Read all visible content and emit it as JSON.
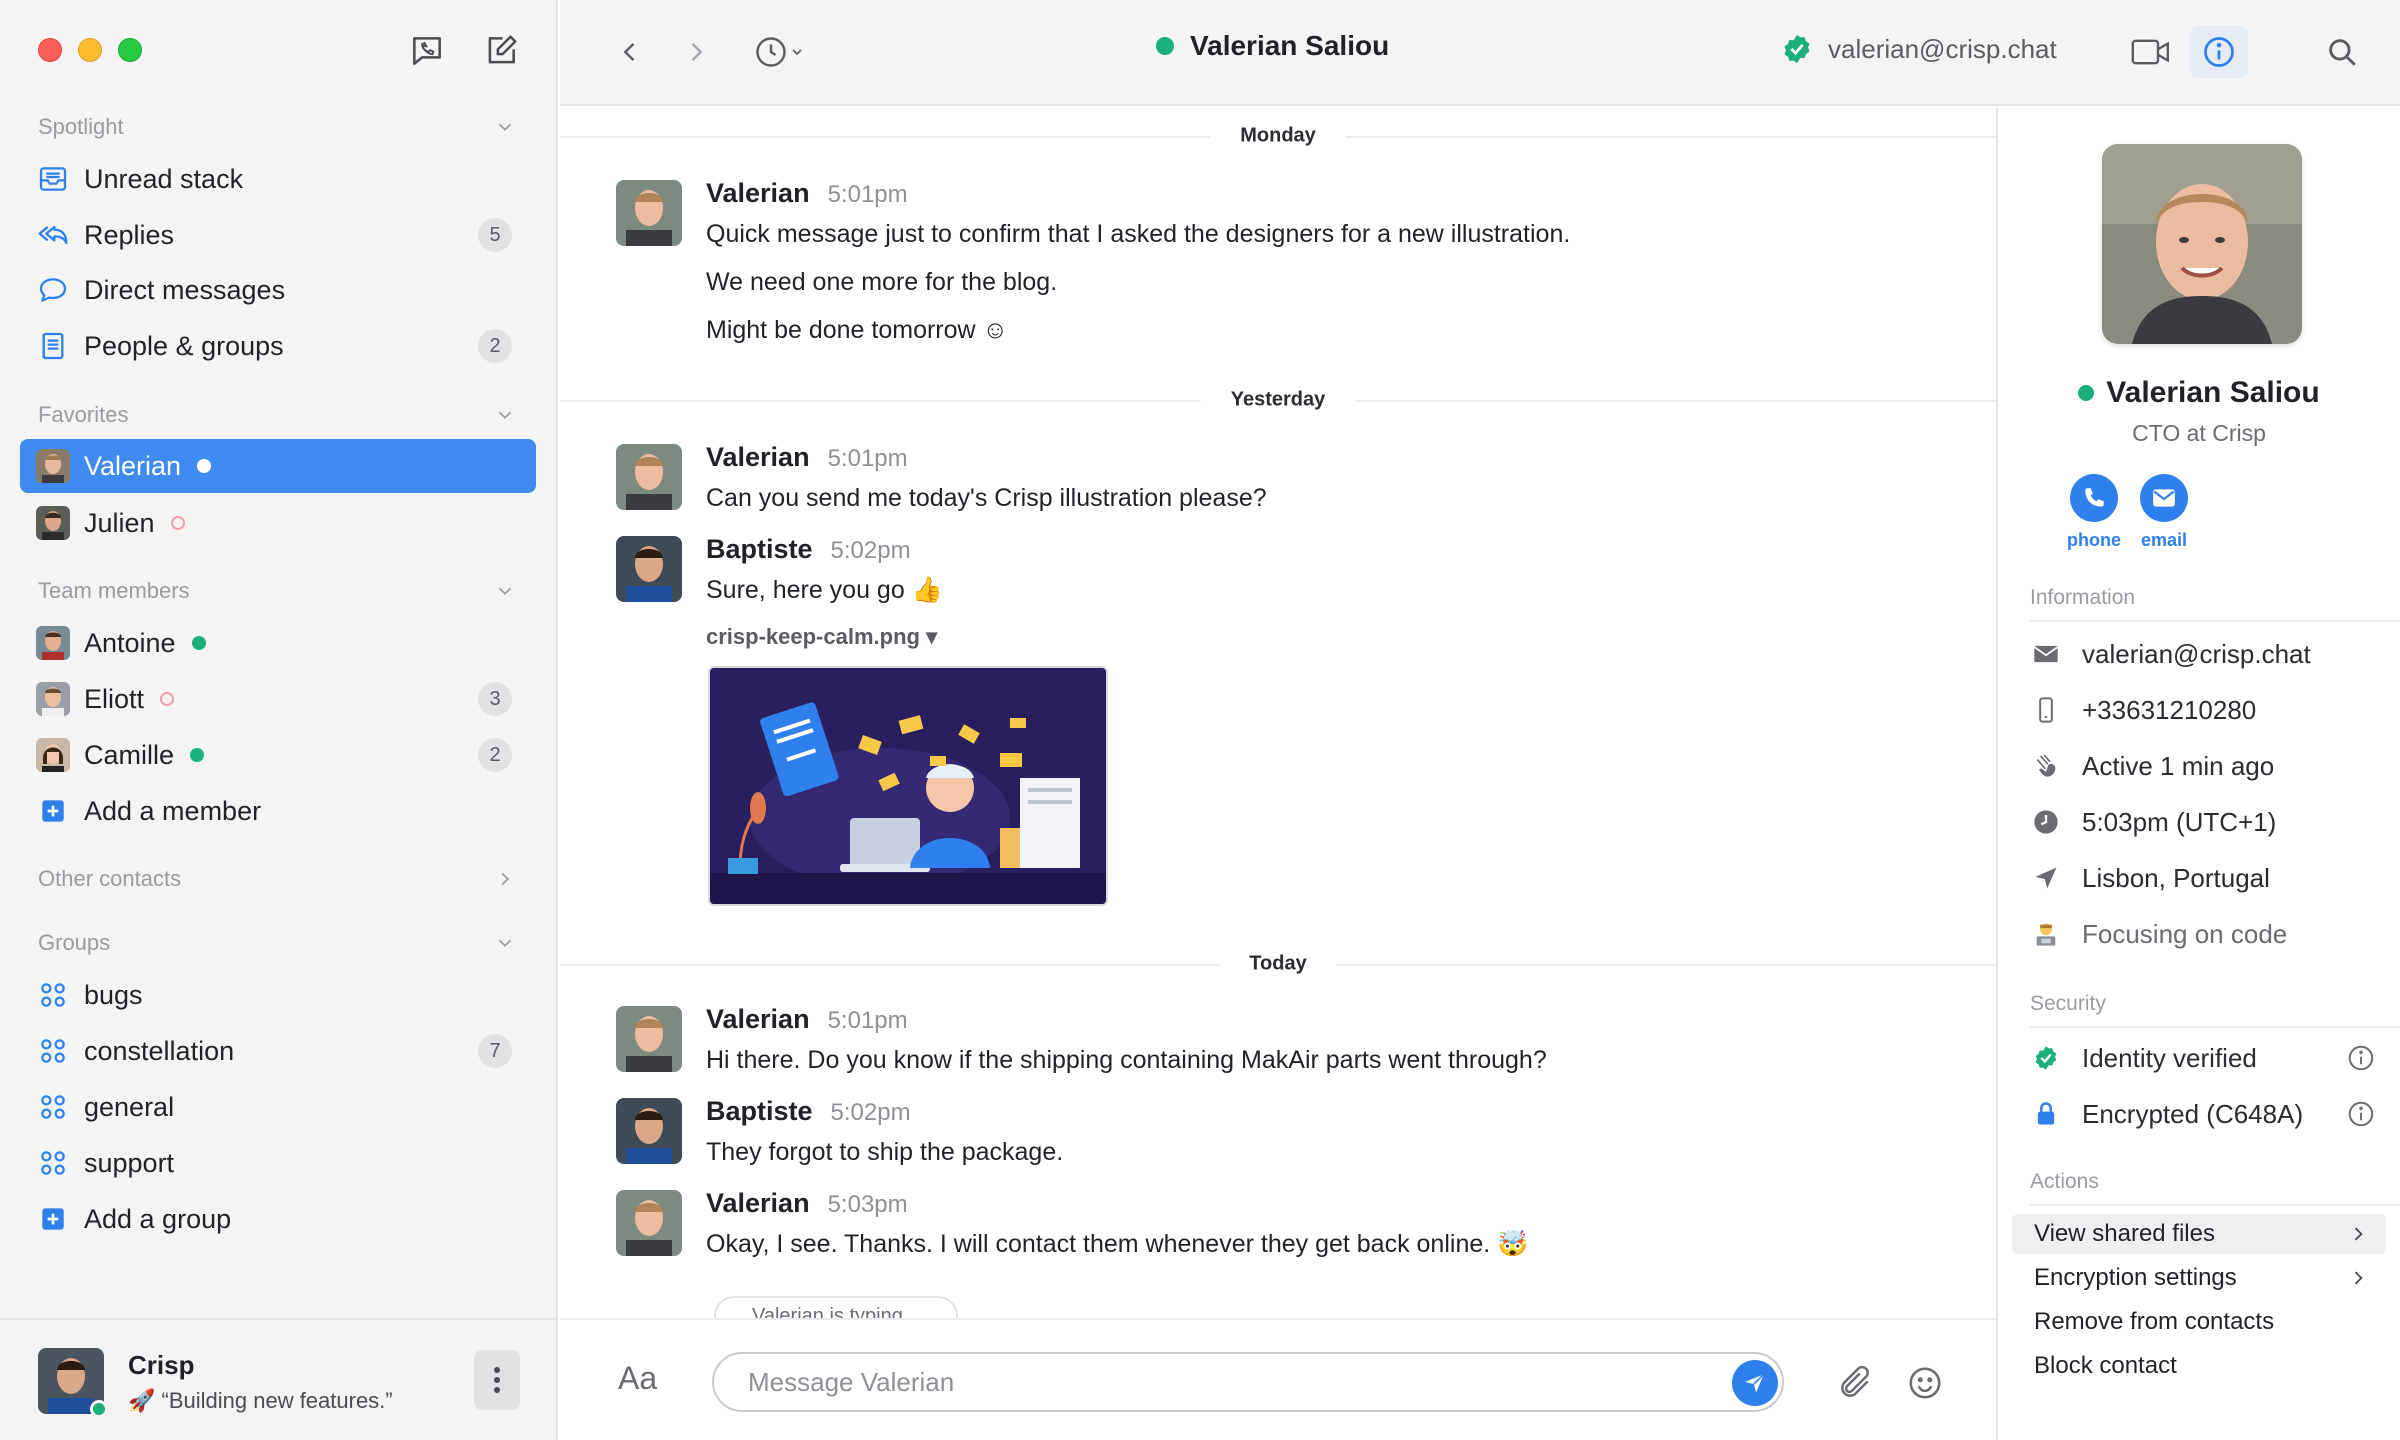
{
  "sidebar": {
    "sections": {
      "spotlight": "Spotlight",
      "favorites": "Favorites",
      "team": "Team members",
      "other": "Other contacts",
      "groups": "Groups"
    },
    "spotlight_items": [
      {
        "label": "Unread stack",
        "icon": "inbox-icon",
        "badge": ""
      },
      {
        "label": "Replies",
        "icon": "reply-all-icon",
        "badge": "5"
      },
      {
        "label": "Direct messages",
        "icon": "chat-bubble-icon",
        "badge": ""
      },
      {
        "label": "People & groups",
        "icon": "address-book-icon",
        "badge": "2"
      }
    ],
    "favorites": [
      {
        "label": "Valerian",
        "status": "online",
        "active": true
      },
      {
        "label": "Julien",
        "status": "offline",
        "active": false
      }
    ],
    "team": [
      {
        "label": "Antoine",
        "status": "online",
        "badge": ""
      },
      {
        "label": "Eliott",
        "status": "offline",
        "badge": "3"
      },
      {
        "label": "Camille",
        "status": "online",
        "badge": "2"
      }
    ],
    "add_member": "Add a member",
    "groups": [
      {
        "label": "bugs",
        "badge": ""
      },
      {
        "label": "constellation",
        "badge": "7"
      },
      {
        "label": "general",
        "badge": ""
      },
      {
        "label": "support",
        "badge": ""
      }
    ],
    "add_group": "Add a group",
    "me": {
      "name": "Crisp",
      "status": "🚀 “Building new features.”"
    }
  },
  "topbar": {
    "title": "Valerian Saliou",
    "email": "valerian@crisp.chat"
  },
  "chat": {
    "days": [
      "Monday",
      "Yesterday",
      "Today"
    ],
    "messages": [
      {
        "author": "Valerian",
        "time": "5:01pm",
        "lines": [
          "Quick message just to confirm that I asked the designers for a new illustration.",
          "We need one more for the blog.",
          "Might be done tomorrow ☺"
        ]
      },
      {
        "author": "Valerian",
        "time": "5:01pm",
        "lines": [
          "Can you send me today's Crisp illustration please?"
        ]
      },
      {
        "author": "Baptiste",
        "time": "5:02pm",
        "lines": [
          "Sure, here you go 👍"
        ],
        "file": "crisp-keep-calm.png ▾"
      },
      {
        "author": "Valerian",
        "time": "5:01pm",
        "lines": [
          "Hi there. Do you know if the shipping containing MakAir parts went through?"
        ]
      },
      {
        "author": "Baptiste",
        "time": "5:02pm",
        "lines": [
          "They forgot to ship the package."
        ]
      },
      {
        "author": "Valerian",
        "time": "5:03pm",
        "lines": [
          "Okay, I see. Thanks. I will contact them whenever they get back online. 🤯"
        ]
      }
    ],
    "typing": "Valerian is typing..."
  },
  "composer": {
    "aa": "Aa",
    "placeholder": "Message Valerian"
  },
  "profile": {
    "name": "Valerian Saliou",
    "role": "CTO at Crisp",
    "actions": {
      "phone": "phone",
      "email": "email"
    },
    "sections": {
      "information": "Information",
      "security": "Security",
      "actions": "Actions"
    },
    "information": [
      {
        "icon": "envelope-icon",
        "value": "valerian@crisp.chat"
      },
      {
        "icon": "mobile-phone-icon",
        "value": "+33631210280"
      },
      {
        "icon": "wave-hand-icon",
        "value": "Active 1 min ago"
      },
      {
        "icon": "clock-icon",
        "value": "5:03pm (UTC+1)"
      },
      {
        "icon": "location-arrow-icon",
        "value": "Lisbon, Portugal"
      },
      {
        "icon": "technologist-emoji-icon",
        "value": "Focusing on code"
      }
    ],
    "security": [
      {
        "icon": "verified-badge-icon",
        "value": "Identity verified"
      },
      {
        "icon": "lock-icon",
        "value": "Encrypted (C648A)"
      }
    ],
    "action_items": [
      {
        "label": "View shared files",
        "chevron": true
      },
      {
        "label": "Encryption settings",
        "chevron": true
      },
      {
        "label": "Remove from contacts",
        "chevron": false
      },
      {
        "label": "Block contact",
        "chevron": false
      }
    ]
  },
  "colors": {
    "accent": "#2f80ed",
    "active_item": "#3f8bf1",
    "online": "#1bb07a"
  }
}
